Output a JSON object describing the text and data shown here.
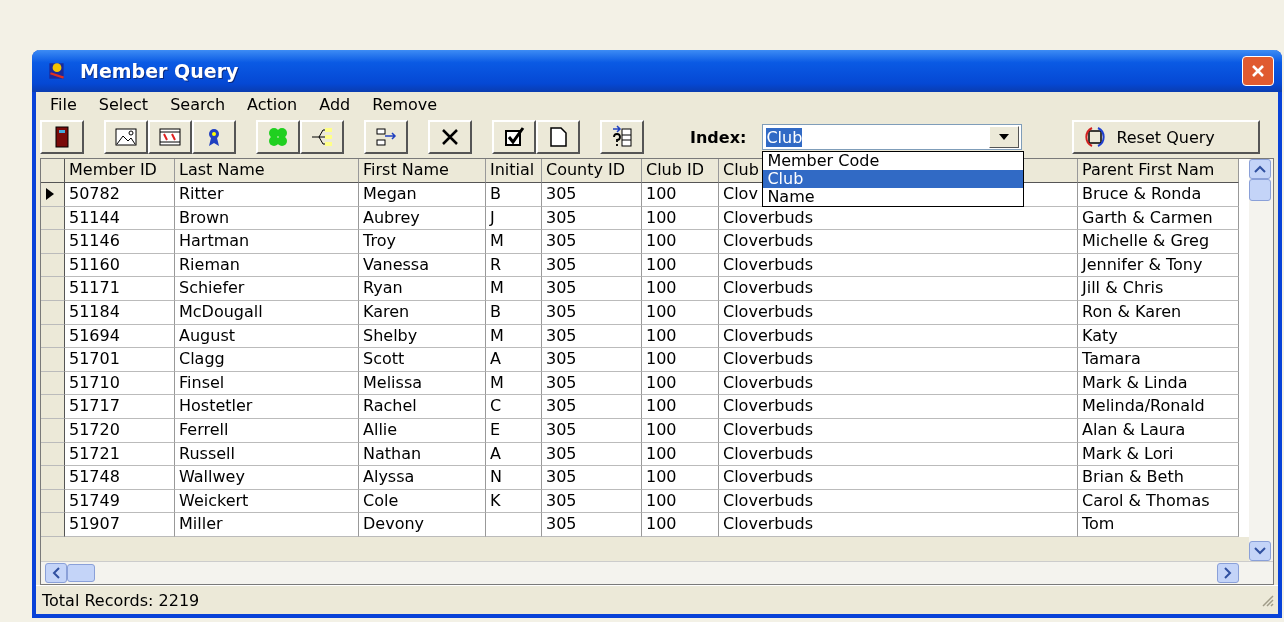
{
  "window": {
    "title": "Member Query"
  },
  "menu": [
    "File",
    "Select",
    "Search",
    "Action",
    "Add",
    "Remove"
  ],
  "index": {
    "label": "Index:",
    "value": "Club",
    "expanded": true,
    "options": [
      {
        "label": "Member Code",
        "selected": false
      },
      {
        "label": "Club",
        "selected": true
      },
      {
        "label": "Name",
        "selected": false
      }
    ]
  },
  "reset_button": "Reset Query",
  "table": {
    "columns": [
      "Member ID",
      "Last Name",
      "First Name",
      "Initial",
      "County ID",
      "Club ID",
      "Club",
      "Parent First Nam"
    ],
    "rows": [
      {
        "current": true,
        "cells": [
          "50782",
          "Ritter",
          "Megan",
          "B",
          "305",
          "100",
          "Clov",
          "Bruce & Ronda"
        ]
      },
      {
        "current": false,
        "cells": [
          "51144",
          "Brown",
          "Aubrey",
          "J",
          "305",
          "100",
          "Cloverbuds",
          "Garth & Carmen"
        ]
      },
      {
        "current": false,
        "cells": [
          "51146",
          "Hartman",
          "Troy",
          "M",
          "305",
          "100",
          "Cloverbuds",
          "Michelle & Greg"
        ]
      },
      {
        "current": false,
        "cells": [
          "51160",
          "Rieman",
          "Vanessa",
          "R",
          "305",
          "100",
          "Cloverbuds",
          "Jennifer & Tony"
        ]
      },
      {
        "current": false,
        "cells": [
          "51171",
          "Schiefer",
          "Ryan",
          "M",
          "305",
          "100",
          "Cloverbuds",
          "Jill & Chris"
        ]
      },
      {
        "current": false,
        "cells": [
          "51184",
          "McDougall",
          "Karen",
          "B",
          "305",
          "100",
          "Cloverbuds",
          "Ron & Karen"
        ]
      },
      {
        "current": false,
        "cells": [
          "51694",
          "August",
          "Shelby",
          "M",
          "305",
          "100",
          "Cloverbuds",
          "Katy"
        ]
      },
      {
        "current": false,
        "cells": [
          "51701",
          "Clagg",
          "Scott",
          "A",
          "305",
          "100",
          "Cloverbuds",
          "Tamara"
        ]
      },
      {
        "current": false,
        "cells": [
          "51710",
          "Finsel",
          "Melissa",
          "M",
          "305",
          "100",
          "Cloverbuds",
          "Mark & Linda"
        ]
      },
      {
        "current": false,
        "cells": [
          "51717",
          "Hostetler",
          "Rachel",
          "C",
          "305",
          "100",
          "Cloverbuds",
          "Melinda/Ronald"
        ]
      },
      {
        "current": false,
        "cells": [
          "51720",
          "Ferrell",
          "Allie",
          "E",
          "305",
          "100",
          "Cloverbuds",
          "Alan & Laura"
        ]
      },
      {
        "current": false,
        "cells": [
          "51721",
          "Russell",
          "Nathan",
          "A",
          "305",
          "100",
          "Cloverbuds",
          "Mark & Lori"
        ]
      },
      {
        "current": false,
        "cells": [
          "51748",
          "Wallwey",
          "Alyssa",
          "N",
          "305",
          "100",
          "Cloverbuds",
          "Brian & Beth"
        ]
      },
      {
        "current": false,
        "cells": [
          "51749",
          "Weickert",
          "Cole",
          "K",
          "305",
          "100",
          "Cloverbuds",
          "Carol & Thomas"
        ]
      },
      {
        "current": false,
        "cells": [
          "51907",
          "Miller",
          "Devony",
          "",
          "305",
          "100",
          "Cloverbuds",
          "Tom"
        ]
      }
    ]
  },
  "status_bar": "Total Records: 2219"
}
